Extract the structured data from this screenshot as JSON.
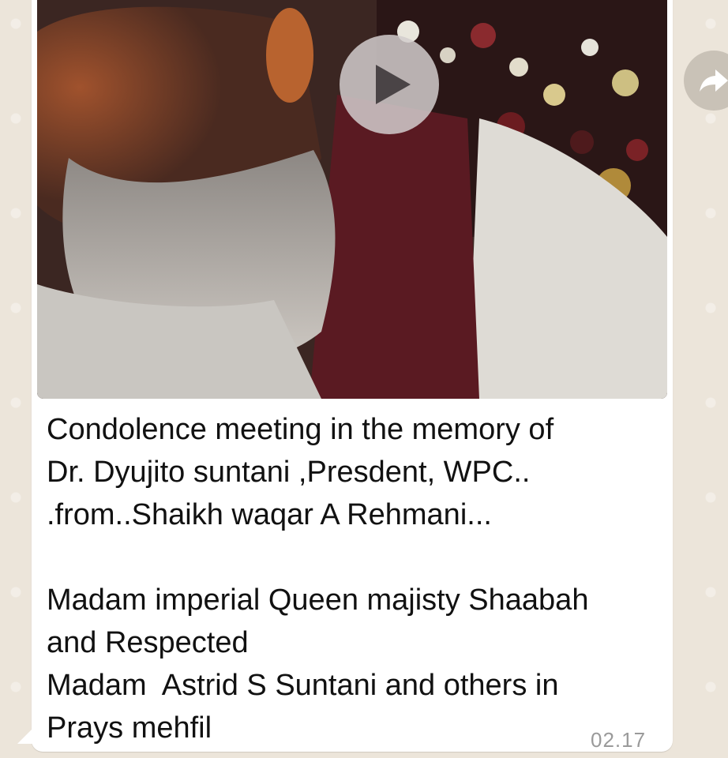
{
  "message": {
    "caption_lines": [
      "Condolence meeting in the memory of",
      "Dr. Dyujito suntani ,Presdent, WPC..",
      ".from..Shaikh waqar A Rehmani...",
      "",
      "Madam imperial Queen majisty Shaabah",
      "and Respected",
      "Madam  Astrid S Suntani and others in",
      "Prays mehfil"
    ],
    "timestamp": "02.17"
  },
  "video": {
    "play_icon": "play-icon",
    "description_icon": "video-thumbnail"
  },
  "actions": {
    "forward_icon": "forward-arrow-icon"
  },
  "colors": {
    "chat_background": "#ece5da",
    "bubble": "#ffffff",
    "timestamp": "#9a9a9a",
    "play_button_bg": "#d2cdcd"
  }
}
